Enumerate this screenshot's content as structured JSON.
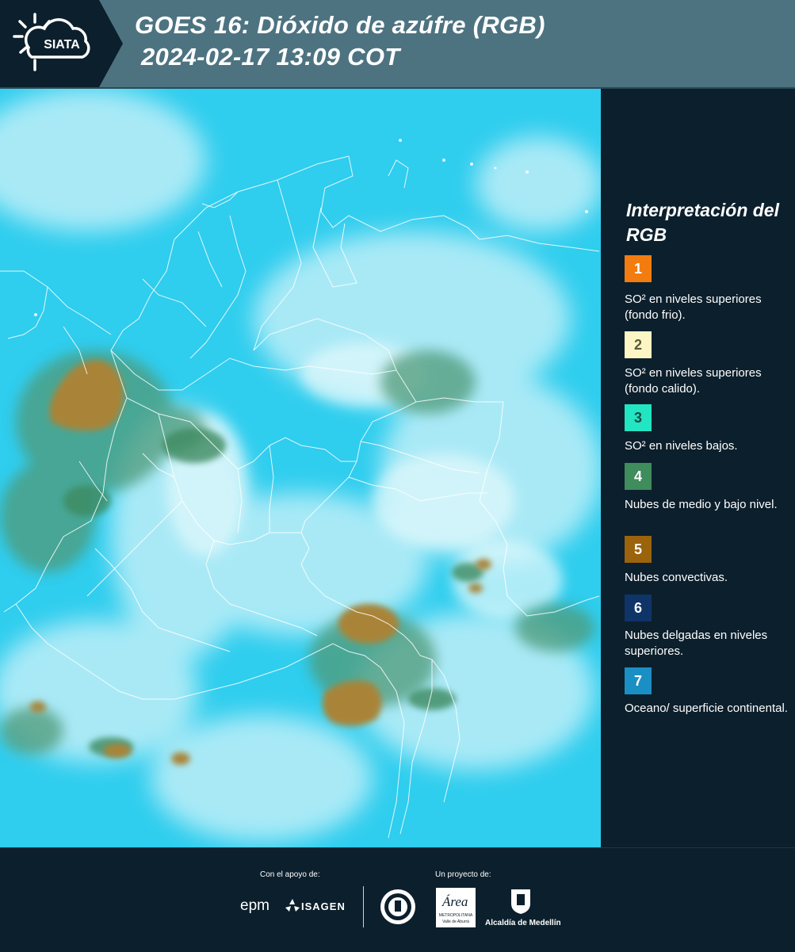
{
  "header": {
    "title_line1": "GOES 16: Dióxido de azúfre (RGB)",
    "title_line2": "2024-02-17 13:09 COT",
    "logo_text": "SIATA"
  },
  "legend": {
    "title": "Interpretación del RGB",
    "items": [
      {
        "number": "1",
        "color": "#f27c10",
        "text_color": "#ffffff",
        "label": "SO² en niveles superiores (fondo frio)."
      },
      {
        "number": "2",
        "color": "#fdf6c4",
        "text_color": "#5a5a3a",
        "label": "SO² en niveles superiores (fondo calido)."
      },
      {
        "number": "3",
        "color": "#22e5c2",
        "text_color": "#1a4a44",
        "label": "SO² en niveles bajos."
      },
      {
        "number": "4",
        "color": "#3f8c5c",
        "text_color": "#ffffff",
        "label": "Nubes de medio y bajo nivel."
      },
      {
        "number": "5",
        "color": "#9a630c",
        "text_color": "#ffffff",
        "label": "Nubes convectivas."
      },
      {
        "number": "6",
        "color": "#0f3468",
        "text_color": "#ffffff",
        "label": "Nubes delgadas en niveles superiores."
      },
      {
        "number": "7",
        "color": "#1a8fc4",
        "text_color": "#ffffff",
        "label": "Oceano/ superficie continental."
      }
    ]
  },
  "footer": {
    "support_label": "Con el apoyo de:",
    "project_label": "Un proyecto de:",
    "epm": "epm",
    "isagen": "ISAGEN",
    "area_metro": "Área",
    "area_metro_sub": "METROPOLITANA",
    "area_metro_sub2": "Valle de Aburrá",
    "alcaldia": "Alcaldía de Medellín"
  },
  "colors": {
    "background": "#0c1f2c",
    "header": "#4d7381",
    "map_base": "#30d2f0",
    "cloud_white": "#d8f6fb",
    "cloud_green": "#5a9a72",
    "convective": "#a8853a"
  }
}
